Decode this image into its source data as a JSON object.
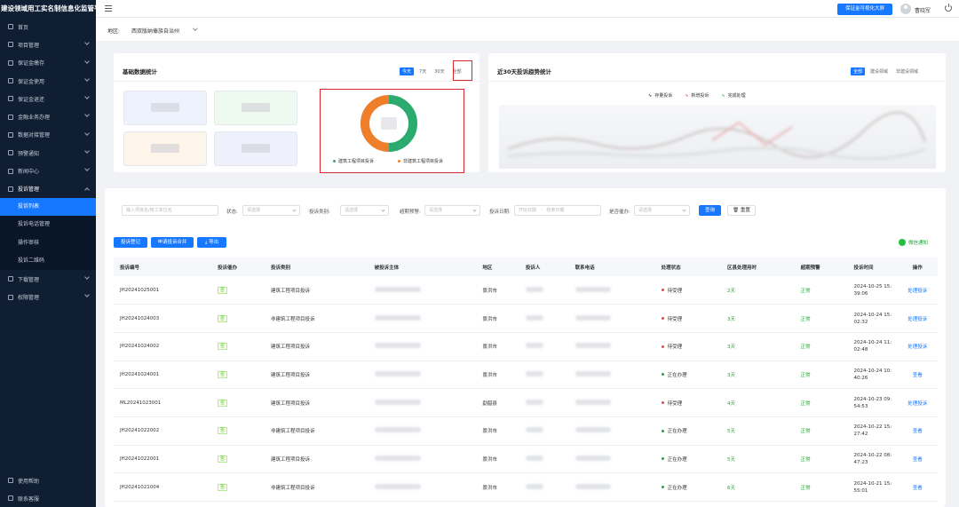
{
  "app": {
    "title": "建设领域用工实名制信息化监管平台"
  },
  "sidebar": {
    "items": [
      {
        "label": "首页",
        "icon": "home-icon",
        "chevron": false
      },
      {
        "label": "项目管理",
        "icon": "project-icon",
        "chevron": true
      },
      {
        "label": "保证金缴存",
        "icon": "deposit-icon",
        "chevron": true
      },
      {
        "label": "保证金使用",
        "icon": "shield-icon",
        "chevron": true
      },
      {
        "label": "保证金退还",
        "icon": "refund-icon",
        "chevron": true
      },
      {
        "label": "金融业务办理",
        "icon": "finance-icon",
        "chevron": true
      },
      {
        "label": "数据对接管理",
        "icon": "data-icon",
        "chevron": true
      },
      {
        "label": "预警通知",
        "icon": "warning-icon",
        "chevron": true
      },
      {
        "label": "新闻中心",
        "icon": "news-icon",
        "chevron": true
      },
      {
        "label": "投诉管理",
        "icon": "complaint-icon",
        "chevron": true,
        "open": true
      }
    ],
    "sub_items": [
      "投诉列表",
      "投诉电话管理",
      "操作审核",
      "投诉二维码"
    ],
    "items_after": [
      {
        "label": "下载管理",
        "icon": "download-icon",
        "chevron": true
      },
      {
        "label": "权限管理",
        "icon": "permission-icon",
        "chevron": true
      }
    ],
    "bottom": [
      {
        "label": "使用帮助",
        "icon": "help-icon"
      },
      {
        "label": "联系客服",
        "icon": "service-icon"
      }
    ]
  },
  "header": {
    "screen_button": "保证金可视化大屏",
    "username": "曹晓军"
  },
  "region": {
    "label": "地区:",
    "value": "西双版纳傣族自治州"
  },
  "stats_card": {
    "title": "基础数据统计",
    "ranges": [
      "今天",
      "7天",
      "30天",
      "全部"
    ],
    "active_range": "今天",
    "donut": {
      "legend": [
        "建筑工程项目投诉",
        "非建筑工程项目投诉"
      ],
      "colors": [
        "#2bab6f",
        "#ef7e2a"
      ],
      "values": [
        0.5,
        0.5
      ]
    }
  },
  "trend_card": {
    "title": "近30天投诉趋势统计",
    "tabs": [
      "全部",
      "建设领域",
      "非建设领域"
    ],
    "active_tab": "全部",
    "legend": [
      {
        "label": "存量投诉",
        "color": "#222222"
      },
      {
        "label": "新增投诉",
        "color": "#e34b4b"
      },
      {
        "label": "完成处理",
        "color": "#48b04b"
      }
    ]
  },
  "filters": {
    "keyword_placeholder": "输入项目名/用工单位名",
    "status_label": "状态:",
    "status_placeholder": "请选择",
    "type_label": "投诉类别:",
    "type_placeholder": "请选择",
    "timeout_label": "超期预警:",
    "timeout_placeholder": "请选择",
    "date_label": "投诉日期:",
    "date_start": "开始日期",
    "date_sep": "-",
    "date_end": "结束日期",
    "urge_label": "是否催办:",
    "urge_placeholder": "请选择",
    "query_button": "查询",
    "reset_button": "重置"
  },
  "actions": {
    "register": "投诉登记",
    "merge": "申请投诉合并",
    "export": "导出",
    "wechat": "微信通知"
  },
  "table": {
    "headers": [
      "投诉编号",
      "投诉催办",
      "投诉类别",
      "被投诉主体",
      "地区",
      "投诉人",
      "联系电话",
      "处理状态",
      "区县处理用时",
      "超期预警",
      "投诉时间",
      "操作"
    ],
    "rows": [
      {
        "id": "JH20241025001",
        "urge": "否",
        "type": "建筑工程项目投诉",
        "region": "景洪市",
        "status": "待受理",
        "status_color": "#e34b4b",
        "time": "2天",
        "warn": "正常",
        "date": "2024-10-25 15:39:06",
        "action": "处理投诉"
      },
      {
        "id": "JH20241024003",
        "urge": "否",
        "type": "非建筑工程项目投诉",
        "region": "景洪市",
        "status": "待受理",
        "status_color": "#e34b4b",
        "time": "3天",
        "warn": "正常",
        "date": "2024-10-24 15:02:32",
        "action": "处理投诉"
      },
      {
        "id": "JH20241024002",
        "urge": "否",
        "type": "建筑工程项目投诉",
        "region": "景洪市",
        "status": "待受理",
        "status_color": "#e34b4b",
        "time": "3天",
        "warn": "正常",
        "date": "2024-10-24 11:02:48",
        "action": "处理投诉"
      },
      {
        "id": "JH20241024001",
        "urge": "否",
        "type": "建筑工程项目投诉",
        "region": "景洪市",
        "status": "正在办理",
        "status_color": "#23a537",
        "time": "3天",
        "warn": "正常",
        "date": "2024-10-24 10:40:26",
        "action": "查看"
      },
      {
        "id": "ML20241023001",
        "urge": "否",
        "type": "建筑工程项目投诉",
        "region": "勐腊县",
        "status": "待受理",
        "status_color": "#e34b4b",
        "time": "4天",
        "warn": "正常",
        "date": "2024-10-23 09:54:53",
        "action": "处理投诉"
      },
      {
        "id": "JH20241022002",
        "urge": "否",
        "type": "非建筑工程项目投诉",
        "region": "景洪市",
        "status": "正在办理",
        "status_color": "#23a537",
        "time": "5天",
        "warn": "正常",
        "date": "2024-10-22 15:27:42",
        "action": "查看"
      },
      {
        "id": "JH20241022001",
        "urge": "否",
        "type": "建筑工程项目投诉",
        "region": "景洪市",
        "status": "正在办理",
        "status_color": "#23a537",
        "time": "5天",
        "warn": "正常",
        "date": "2024-10-22 08:47:23",
        "action": "查看"
      },
      {
        "id": "JH20241021004",
        "urge": "否",
        "type": "非建筑工程项目投诉",
        "region": "景洪市",
        "status": "正在办理",
        "status_color": "#23a537",
        "time": "6天",
        "warn": "正常",
        "date": "2024-10-21 15:55:01",
        "action": "查看"
      }
    ]
  }
}
